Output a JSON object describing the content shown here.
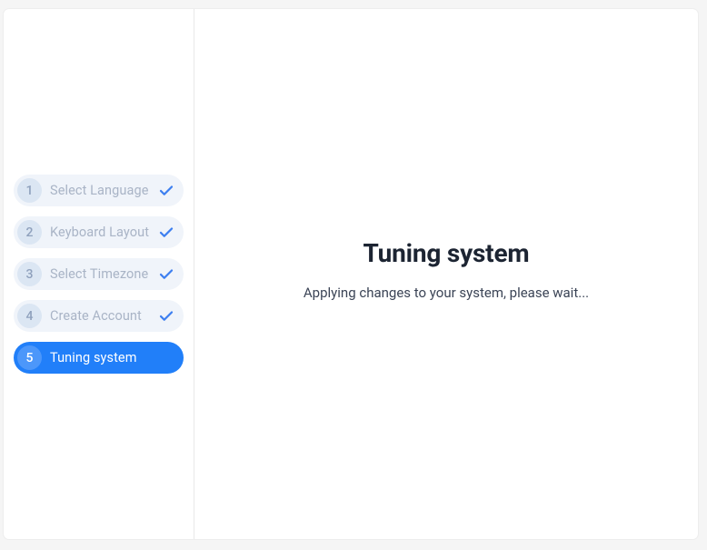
{
  "steps": [
    {
      "n": "1",
      "label": "Select Language",
      "done": true,
      "active": false
    },
    {
      "n": "2",
      "label": "Keyboard Layout",
      "done": true,
      "active": false
    },
    {
      "n": "3",
      "label": "Select Timezone",
      "done": true,
      "active": false
    },
    {
      "n": "4",
      "label": "Create Account",
      "done": true,
      "active": false
    },
    {
      "n": "5",
      "label": "Tuning system",
      "done": false,
      "active": true
    }
  ],
  "main": {
    "title": "Tuning system",
    "subtitle": "Applying changes to your system, please wait..."
  },
  "colors": {
    "accent": "#217ff9",
    "step_bg": "#f0f4fa",
    "step_text_inactive": "#a9b4c6"
  }
}
